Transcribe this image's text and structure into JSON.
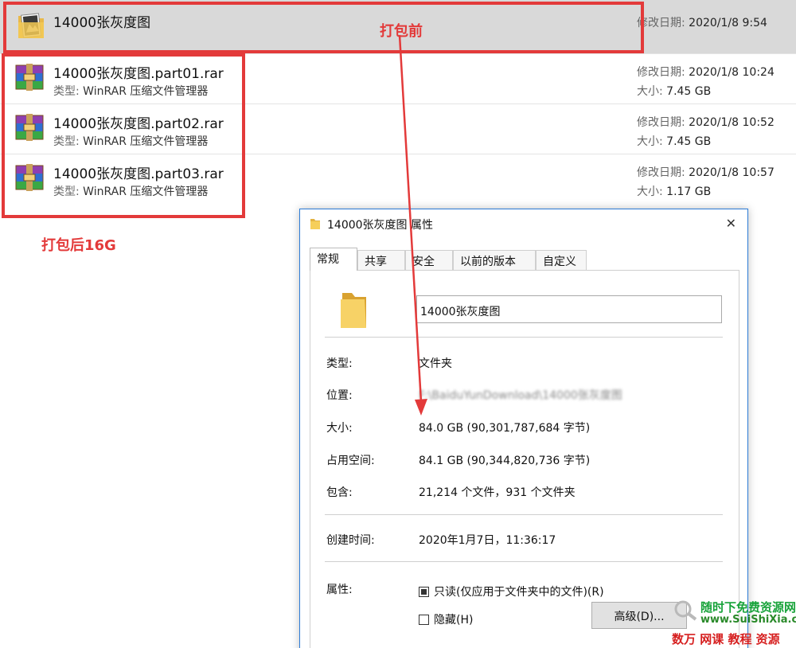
{
  "explorer": {
    "folder": {
      "name": "14000张灰度图",
      "date_key": "修改日期:",
      "date_value": "2020/1/8 9:54"
    },
    "archives": [
      {
        "name": "14000张灰度图.part01.rar",
        "type_key": "类型:",
        "type_value": "WinRAR 压缩文件管理器",
        "date_key": "修改日期:",
        "date_value": "2020/1/8 10:24",
        "size_key": "大小:",
        "size_value": "7.45 GB"
      },
      {
        "name": "14000张灰度图.part02.rar",
        "type_key": "类型:",
        "type_value": "WinRAR 压缩文件管理器",
        "date_key": "修改日期:",
        "date_value": "2020/1/8 10:52",
        "size_key": "大小:",
        "size_value": "7.45 GB"
      },
      {
        "name": "14000张灰度图.part03.rar",
        "type_key": "类型:",
        "type_value": "WinRAR 压缩文件管理器",
        "date_key": "修改日期:",
        "date_value": "2020/1/8 10:57",
        "size_key": "大小:",
        "size_value": "1.17 GB"
      }
    ]
  },
  "annotations": {
    "before_label": "打包前",
    "after_label": "打包后16G",
    "color": "#e33a3a"
  },
  "dialog": {
    "title": "14000张灰度图 属性",
    "close_glyph": "✕",
    "tabs": [
      "常规",
      "共享",
      "安全",
      "以前的版本",
      "自定义"
    ],
    "active_tab": "常规",
    "name_value": "14000张灰度图",
    "rows": {
      "type": {
        "label": "类型:",
        "value": "文件夹"
      },
      "location": {
        "label": "位置:",
        "value": "F:\\BaiduYunDownload\\14000张灰度图"
      },
      "size": {
        "label": "大小:",
        "value": "84.0 GB (90,301,787,684 字节)"
      },
      "size_on_disk": {
        "label": "占用空间:",
        "value": "84.1 GB (90,344,820,736 字节)"
      },
      "contains": {
        "label": "包含:",
        "value": "21,214 个文件，931 个文件夹"
      },
      "created": {
        "label": "创建时间:",
        "value": "2020年1月7日，11:36:17"
      },
      "attributes": {
        "label": "属性:"
      }
    },
    "readonly_label": "只读(仅应用于文件夹中的文件)(R)",
    "readonly_checked": true,
    "hidden_label": "隐藏(H)",
    "hidden_checked": false,
    "advanced_label": "高级(D)..."
  },
  "watermark": {
    "line1": "随时下免费资源网",
    "line2": "www.SuiShiXia.com",
    "line3": "数万 网课 教程 资源"
  },
  "icons": {
    "folder_row": "image-folder-icon",
    "rar": "winrar-archive-icon",
    "dialog_title": "folder-icon",
    "dialog_big": "folder-icon",
    "close": "close-icon"
  }
}
